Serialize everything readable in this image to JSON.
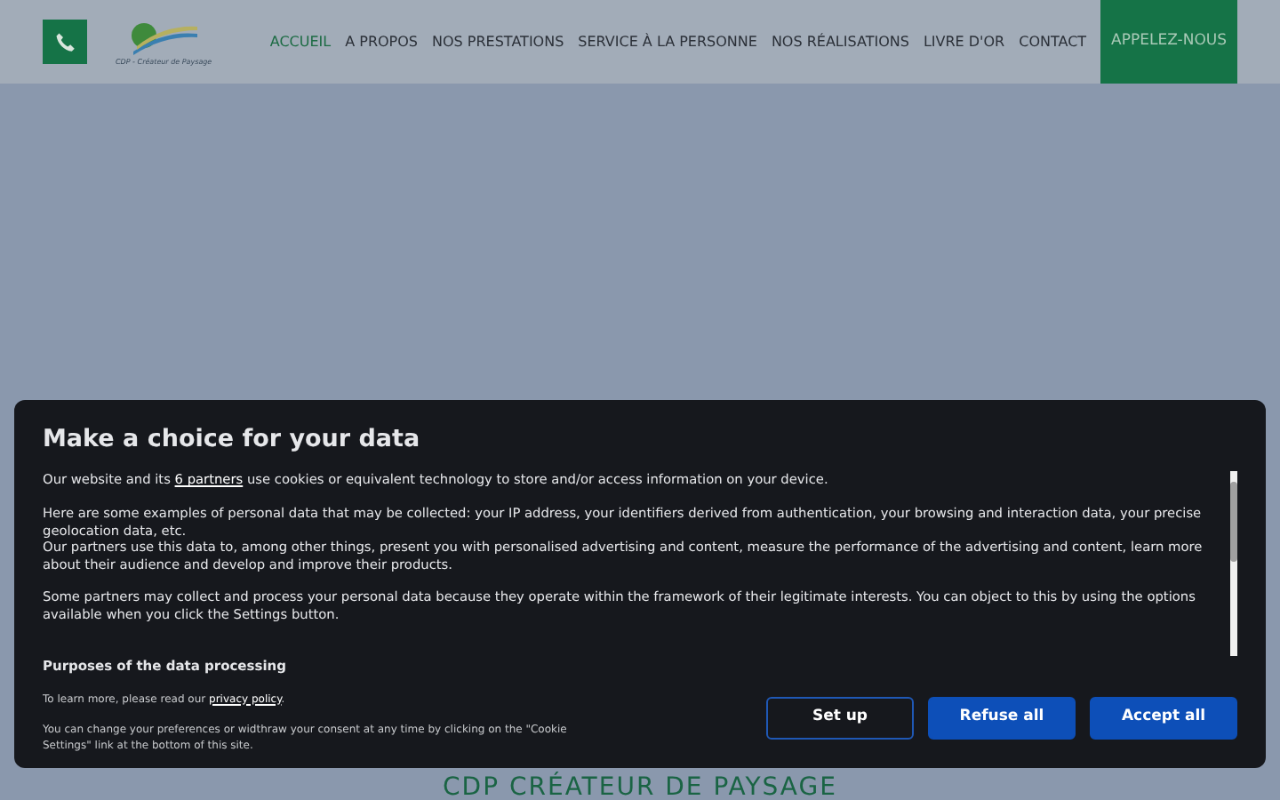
{
  "header": {
    "logo_caption": "CDP - Créateur de Paysage",
    "nav": [
      {
        "label": "ACCUEIL",
        "selected": true
      },
      {
        "label": "A PROPOS",
        "selected": false
      },
      {
        "label": "NOS PRESTATIONS",
        "selected": false
      },
      {
        "label": "SERVICE À LA PERSONNE",
        "selected": false
      },
      {
        "label": "NOS RÉALISATIONS",
        "selected": false
      },
      {
        "label": "LIVRE D'OR",
        "selected": false
      },
      {
        "label": "CONTACT",
        "selected": false
      }
    ],
    "cta": "APPELEZ-NOUS"
  },
  "page_heading": "CDP CRÉATEUR DE PAYSAGE",
  "consent": {
    "title": "Make a choice for your data",
    "intro": {
      "before": "Our website and its",
      "link": "6 partners",
      "after": "use cookies or equivalent technology to store and/or access information on your device."
    },
    "paragraphs": [
      "Here are some examples of personal data that may be collected: your IP address, your identifiers derived from authentication, your browsing and interaction data, your precise geolocation data, etc.",
      "Our partners use this data to, among other things, present you with personalised advertising and content, measure the performance of the advertising and content, learn more about their audience and develop and improve their products.",
      "Some partners may collect and process your personal data because they operate within the framework of their legitimate interests. You can object to this by using the options available when you click the Settings button."
    ],
    "section_title": "Purposes of the data processing",
    "learn_more": {
      "before": "To learn more, please read our",
      "link": "privacy policy",
      "after": "."
    },
    "notice": "You can change your preferences or widthraw your consent at any time by clicking on the \"Cookie Settings\" link at the bottom of this site.",
    "buttons": [
      {
        "label": "Set up",
        "kind": "outline"
      },
      {
        "label": "Refuse all",
        "kind": "solid"
      },
      {
        "label": "Accept all",
        "kind": "solid"
      }
    ]
  }
}
